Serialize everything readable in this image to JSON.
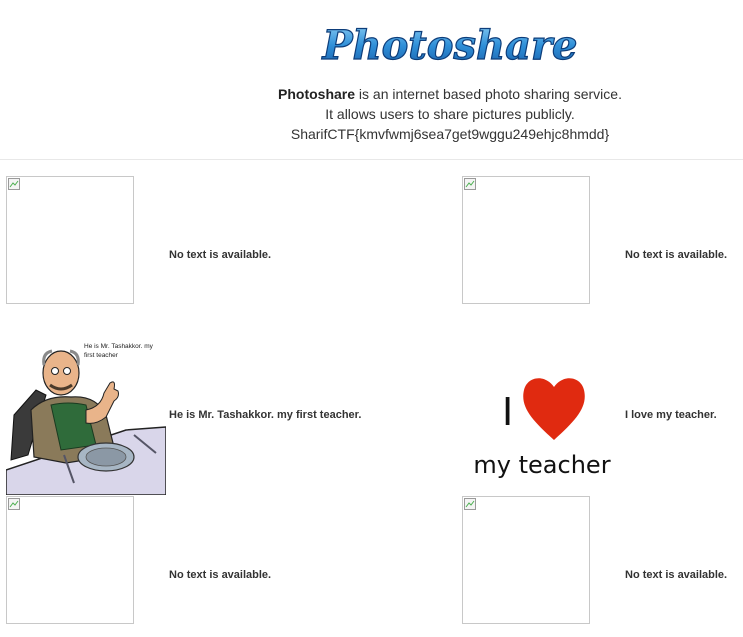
{
  "header": {
    "logo_text": "Photoshare",
    "intro_brand": "Photoshare",
    "intro_line1_rest": " is an internet based photo sharing service.",
    "intro_line2": "It allows users to share pictures publicly.",
    "intro_line3": "SharifCTF{kmvfwmj6sea7get9wggu249ehjc8hmdd}"
  },
  "photos": [
    {
      "caption": "No text is available.",
      "image": "broken-image-icon"
    },
    {
      "caption": "No text is available.",
      "image": "broken-image-icon"
    },
    {
      "caption": "He is Mr. Tashakkor. my first teacher.",
      "image": "teacher-cartoon",
      "bubble_line1": "He is Mr. Tashakkor. my",
      "bubble_line2": "first teacher"
    },
    {
      "caption": "I love my teacher.",
      "image": "heart-icon",
      "image_text_top": "I",
      "image_text_bottom": "my teacher"
    },
    {
      "caption": "No text is available.",
      "image": "broken-image-icon"
    },
    {
      "caption": "No text is available.",
      "image": "broken-image-icon"
    }
  ]
}
